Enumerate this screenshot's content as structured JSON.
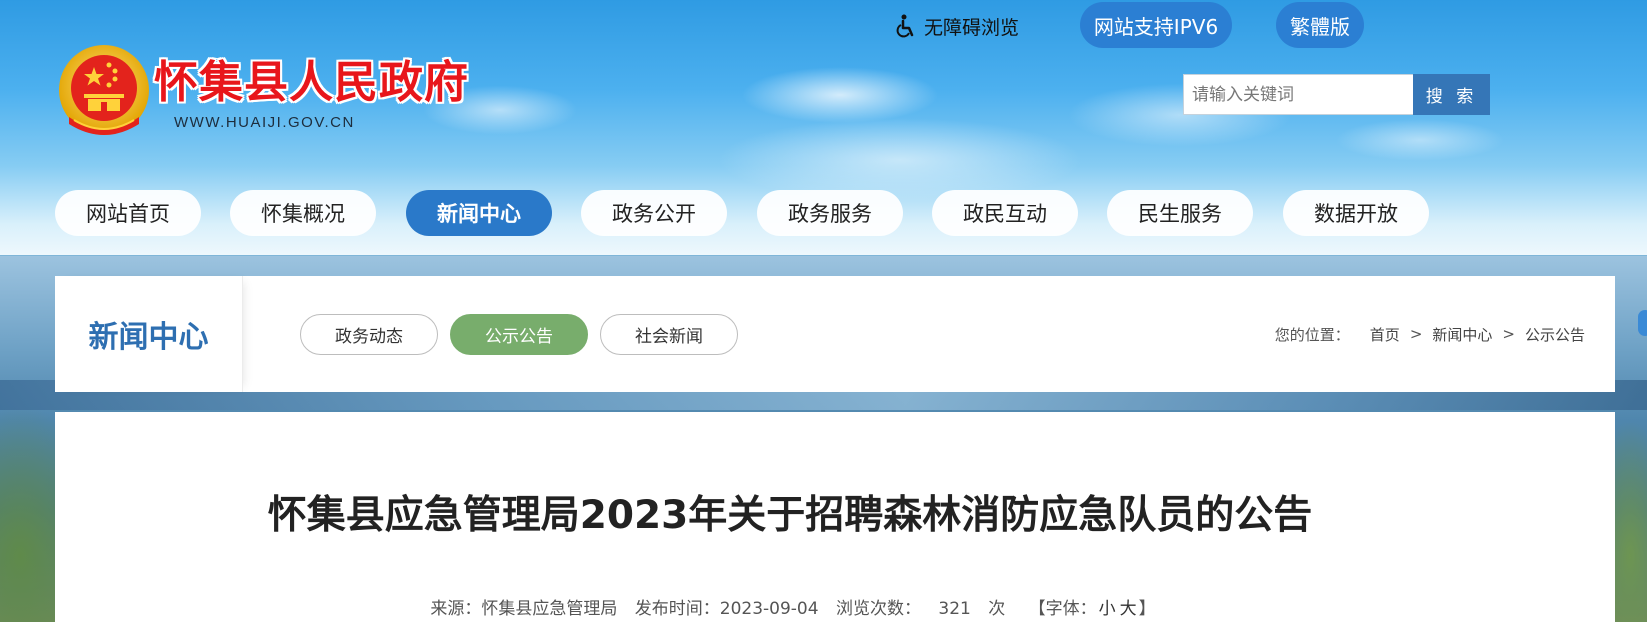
{
  "header": {
    "site_name": "怀集县人民政府",
    "site_domain": "WWW.HUAIJI.GOV.CN",
    "accessibility_label": "无障碍浏览",
    "ipv6_label": "网站支持IPV6",
    "traditional_label": "繁體版",
    "search": {
      "placeholder": "请输入关键词",
      "button_label": "搜 索"
    }
  },
  "nav": {
    "items": [
      {
        "label": "网站首页",
        "active": false
      },
      {
        "label": "怀集概况",
        "active": false
      },
      {
        "label": "新闻中心",
        "active": true
      },
      {
        "label": "政务公开",
        "active": false
      },
      {
        "label": "政务服务",
        "active": false
      },
      {
        "label": "政民互动",
        "active": false
      },
      {
        "label": "民生服务",
        "active": false
      },
      {
        "label": "数据开放",
        "active": false
      }
    ]
  },
  "section": {
    "title": "新闻中心",
    "subtabs": [
      {
        "label": "政务动态",
        "active": false
      },
      {
        "label": "公示公告",
        "active": true
      },
      {
        "label": "社会新闻",
        "active": false
      }
    ],
    "breadcrumb": {
      "prefix": "您的位置：",
      "items": [
        "首页",
        "新闻中心",
        "公示公告"
      ],
      "separator": ">"
    }
  },
  "article": {
    "title": "怀集县应急管理局2023年关于招聘森林消防应急队员的公告",
    "meta": {
      "source_label": "来源：怀集县应急管理局",
      "date_label": "发布时间：2023-09-04",
      "views_label": "浏览次数：",
      "views_count": "321",
      "views_unit": "次",
      "font_label": "【字体：",
      "font_small": "小",
      "font_large": "大",
      "font_close": "】"
    }
  },
  "colors": {
    "brand_blue": "#2a79c9",
    "site_name_red": "#e8161b",
    "subtab_active_green": "#78ad6c",
    "section_title_blue": "#2e6fb1"
  }
}
